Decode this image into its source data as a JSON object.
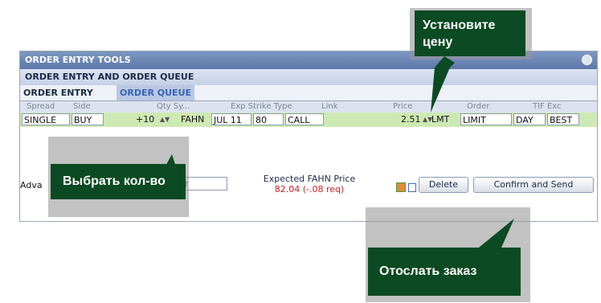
{
  "window": {
    "title": "ORDER ENTRY TOOLS",
    "subtitle": "ORDER ENTRY AND ORDER QUEUE"
  },
  "tabs": [
    {
      "label": "ORDER ENTRY",
      "active": false
    },
    {
      "label": "ORDER QUEUE",
      "active": true
    }
  ],
  "columns": [
    "Spread",
    "Side",
    "Qty Sy...",
    "Exp Strike Type",
    "Link",
    "Price",
    "Order",
    "TIF Exc"
  ],
  "order_row": {
    "spread": "SINGLE",
    "side": "BUY",
    "qty": "+10",
    "symbol": "FAHN",
    "exp": "JUL 11",
    "strike": "80",
    "type": "CALL",
    "price": "2.51",
    "price_type": "LMT",
    "order": "LIMIT",
    "tif": "DAY",
    "exchange": "BEST"
  },
  "advanced": {
    "label": "Adva",
    "selected": "r"
  },
  "expected": {
    "title": "Expected FAHN Price",
    "value": "82.04 (-.08 req)"
  },
  "buttons": {
    "delete": "Delete",
    "confirm": "Confirm and Send"
  },
  "callouts": {
    "set_price": "Установите цену",
    "choose_qty": "Выбрать кол-во",
    "send_order": "Отослать заказ"
  },
  "colors": {
    "callout_bg": "#0c4a23",
    "title_bar": "#5d78aa",
    "row_bg": "#cfe9b4",
    "active_tab": "#3c63b4",
    "expected_value": "#cc2222"
  }
}
